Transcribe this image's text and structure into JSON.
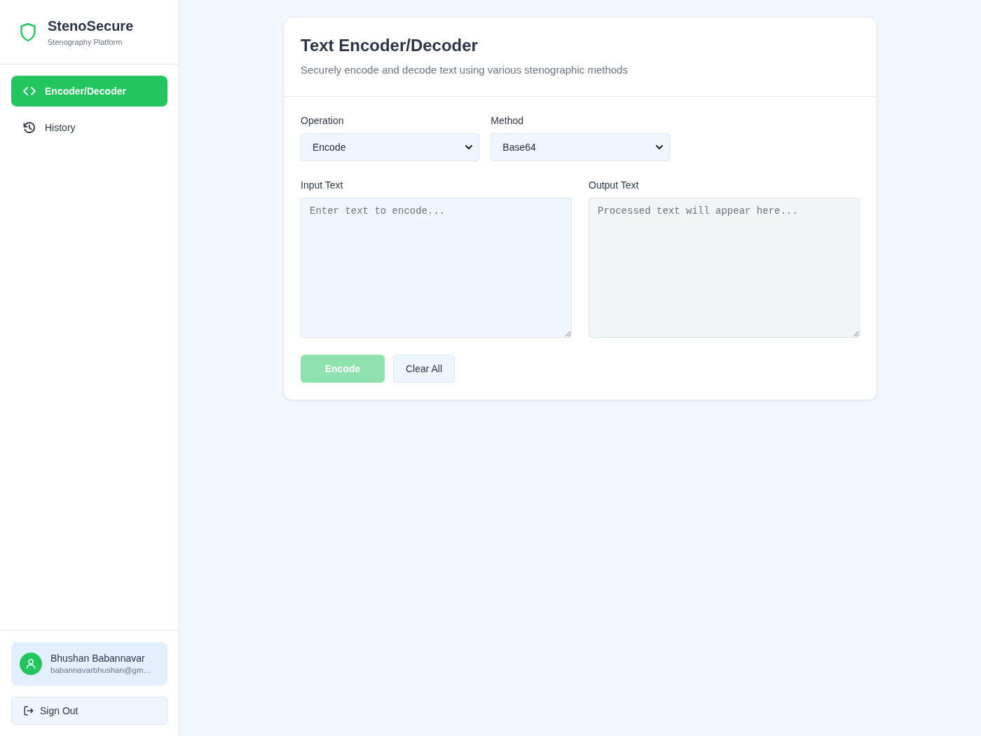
{
  "sidebar": {
    "brand": {
      "name": "StenoSecure",
      "tagline": "Stenography Platform"
    },
    "nav_items": [
      {
        "label": "Encoder/Decoder",
        "kind": "code",
        "selected": true
      },
      {
        "label": "History",
        "kind": "history",
        "selected": false
      }
    ],
    "user": {
      "name": "Bhushan Babannavar",
      "email": "babannavarbhushan@gm…"
    },
    "sign_out": {
      "label": "Sign Out"
    }
  },
  "card": {
    "title": "Text Encoder/Decoder",
    "subtitle": "Securely encode and decode text using various stenographic methods",
    "selects": [
      {
        "label": "Operation",
        "value": "Encode"
      },
      {
        "label": "Method",
        "value": "Base64"
      }
    ],
    "text_areas": [
      {
        "label": "Input Text",
        "placeholder": "Enter text to encode...",
        "kind": "input"
      },
      {
        "label": "Output Text",
        "placeholder": "Processed text will appear here...",
        "kind": "output"
      }
    ],
    "buttons": [
      {
        "label": "Encode",
        "kind": "primary",
        "disabled": true
      },
      {
        "label": "Clear All",
        "kind": "secondary",
        "disabled": false
      }
    ]
  }
}
